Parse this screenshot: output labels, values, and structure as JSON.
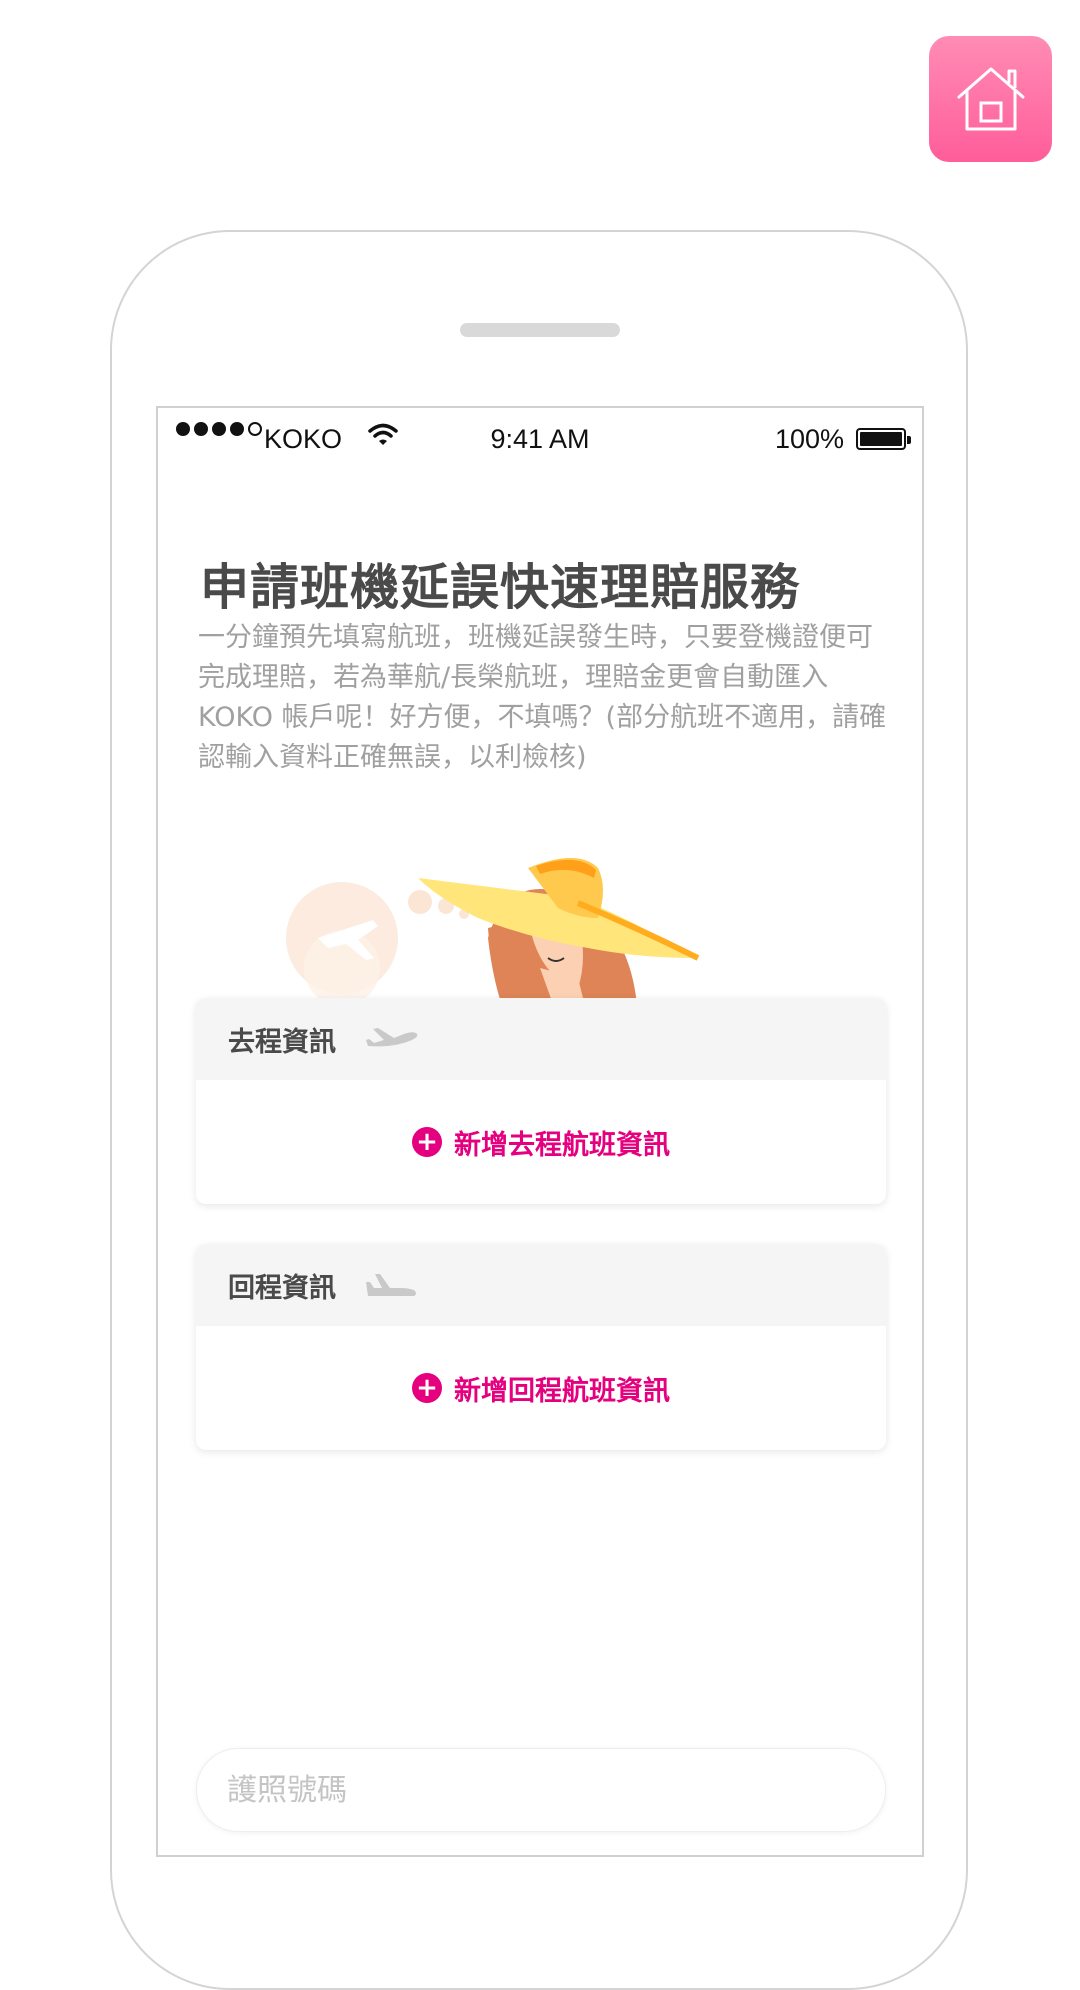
{
  "status_bar": {
    "carrier": "KOKO",
    "time": "9:41 AM",
    "battery": "100%"
  },
  "content": {
    "title": "申請班機延誤快速理賠服務",
    "description": "一分鐘預先填寫航班，班機延誤發生時，只要登機證便可完成理賠，若為華航/長榮航班，理賠金更會自動匯入 KOKO 帳戶呢！好方便，不填嗎？(部分航班不適用，請確認輸入資料正確無誤，以利檢核)"
  },
  "outbound": {
    "header": "去程資訊",
    "add_label": "新增去程航班資訊"
  },
  "return": {
    "header": "回程資訊",
    "add_label": "新增回程航班資訊"
  },
  "passport": {
    "placeholder": "護照號碼"
  },
  "colors": {
    "accent": "#e4007f",
    "home_button": "#ff6fa5"
  },
  "icons": [
    "home-icon",
    "wifi-icon",
    "battery-icon",
    "airplane-takeoff-icon",
    "airplane-landing-icon",
    "plus-circle-icon"
  ]
}
